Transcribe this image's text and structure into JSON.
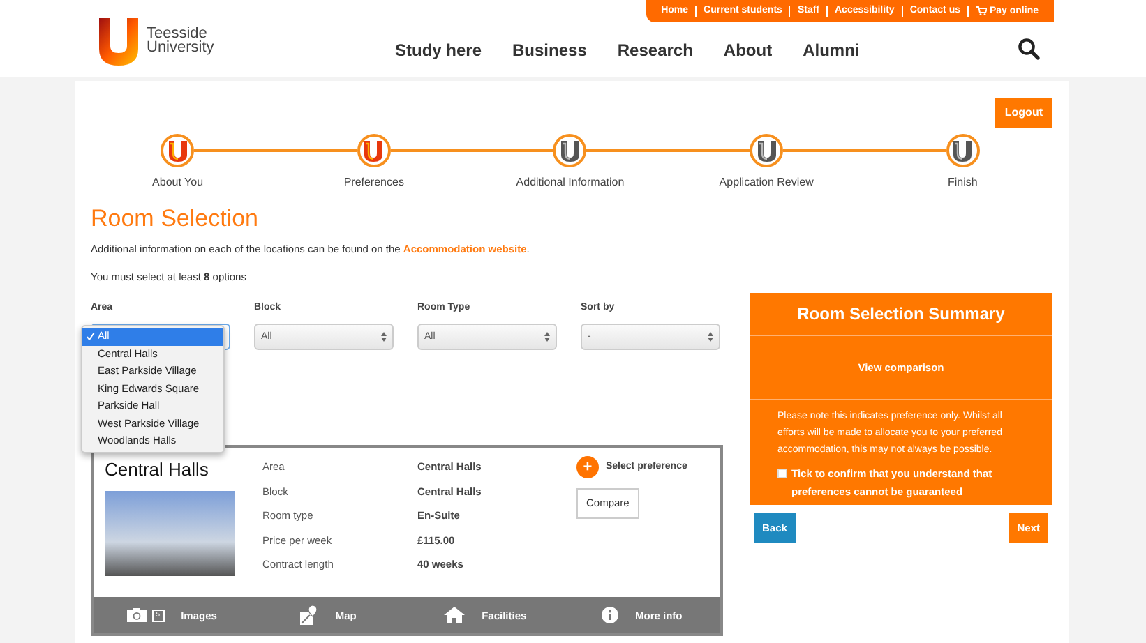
{
  "header": {
    "logo_text": [
      "Teesside",
      "University"
    ],
    "top_links": [
      "Home",
      "Current students",
      "Staff",
      "Accessibility",
      "Contact us",
      "Pay online"
    ],
    "nav": [
      "Study here",
      "Business",
      "Research",
      "About",
      "Alumni"
    ]
  },
  "logout": "Logout",
  "steps": [
    {
      "label": "About You",
      "completed": true
    },
    {
      "label": "Preferences",
      "completed": true
    },
    {
      "label": "Additional Information",
      "completed": false
    },
    {
      "label": "Application Review",
      "completed": false
    },
    {
      "label": "Finish",
      "completed": false
    }
  ],
  "title": "Room Selection",
  "intro": "Additional information on each of the locations can be found on the ",
  "intro_link": "Accommodation website",
  "intro_end": ".",
  "minimum": "You must select at least **8** options",
  "filters": [
    {
      "label": "Area",
      "open": true
    },
    {
      "label": "Block",
      "value": "All",
      "open": false
    },
    {
      "label": "Room Type",
      "value": "All",
      "open": false
    },
    {
      "label": "Sort by",
      "value": "-",
      "open": false
    }
  ],
  "area_options": [
    {
      "label": "All",
      "selected": true
    },
    {
      "label": "Central Halls",
      "selected": false
    },
    {
      "label": "East Parkside Village",
      "selected": false
    },
    {
      "label": "King Edwards Square",
      "selected": false
    },
    {
      "label": "Parkside Hall",
      "selected": false
    },
    {
      "label": "West Parkside Village",
      "selected": false
    },
    {
      "label": "Woodlands Halls",
      "selected": false
    }
  ],
  "room": {
    "name": "Central Halls",
    "details": [
      {
        "label": "Area",
        "value": "Central Halls"
      },
      {
        "label": "Block",
        "value": "Central Halls"
      },
      {
        "label": "Room type",
        "value": "En-Suite"
      },
      {
        "label": "Price per week",
        "value": "£115.00"
      },
      {
        "label": "Contract length",
        "value": "40 weeks"
      }
    ],
    "select": "Select preference",
    "plus": "+",
    "compare": "Compare",
    "tabs": [
      {
        "label": "Images",
        "kind": "images",
        "count": "5"
      },
      {
        "label": "Map",
        "kind": "map"
      },
      {
        "label": "Facilities",
        "kind": "facilities"
      },
      {
        "label": "More info",
        "kind": "info"
      }
    ]
  },
  "summary": {
    "title": "Room Selection Summary",
    "view": "View comparison",
    "note": "Please note this indicates preference only. Whilst all efforts will be made to allocate you to your preferred accommodation, this may not always be possible.",
    "confirm": "Tick to confirm that you understand that preferences cannot be guaranteed",
    "checked": false
  },
  "back": "Back",
  "next": "Next"
}
